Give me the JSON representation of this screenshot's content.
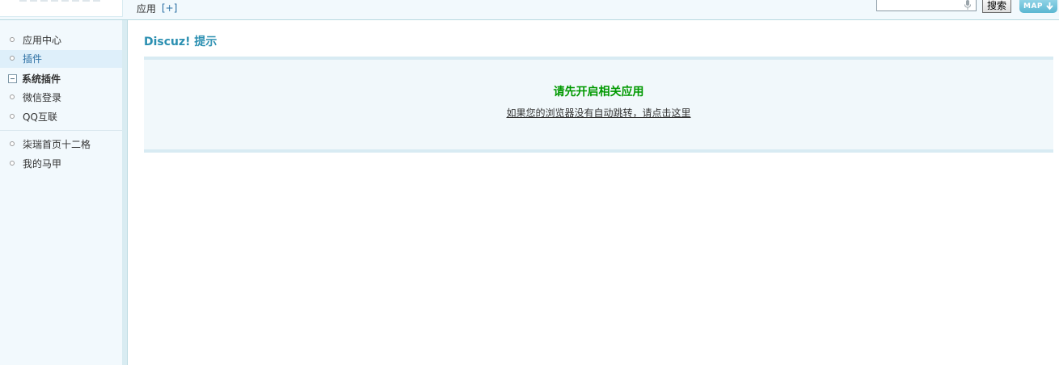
{
  "header": {
    "breadcrumb": "应用",
    "add_link": "[+]",
    "search": {
      "value": "",
      "placeholder": "",
      "button_label": "搜索"
    },
    "map_button": "MAP"
  },
  "sidebar": {
    "items": [
      {
        "label": "应用中心"
      },
      {
        "label": "插件",
        "active": true
      }
    ],
    "group": {
      "label": "系统插件",
      "items": [
        {
          "label": "微信登录"
        },
        {
          "label": "QQ互联"
        }
      ]
    },
    "extra_items": [
      {
        "label": "柒瑞首页十二格"
      },
      {
        "label": "我的马甲"
      }
    ]
  },
  "main": {
    "title": "Discuz! 提示",
    "message": "请先开启相关应用",
    "redirect_link": "如果您的浏览器没有自动跳转，请点击这里"
  },
  "colors": {
    "title": "#2b8fb1",
    "message": "#009900",
    "sidebar_bg": "#f2f9fd",
    "active_item_bg": "#deeffa",
    "box_bg": "#f1f8fb"
  }
}
